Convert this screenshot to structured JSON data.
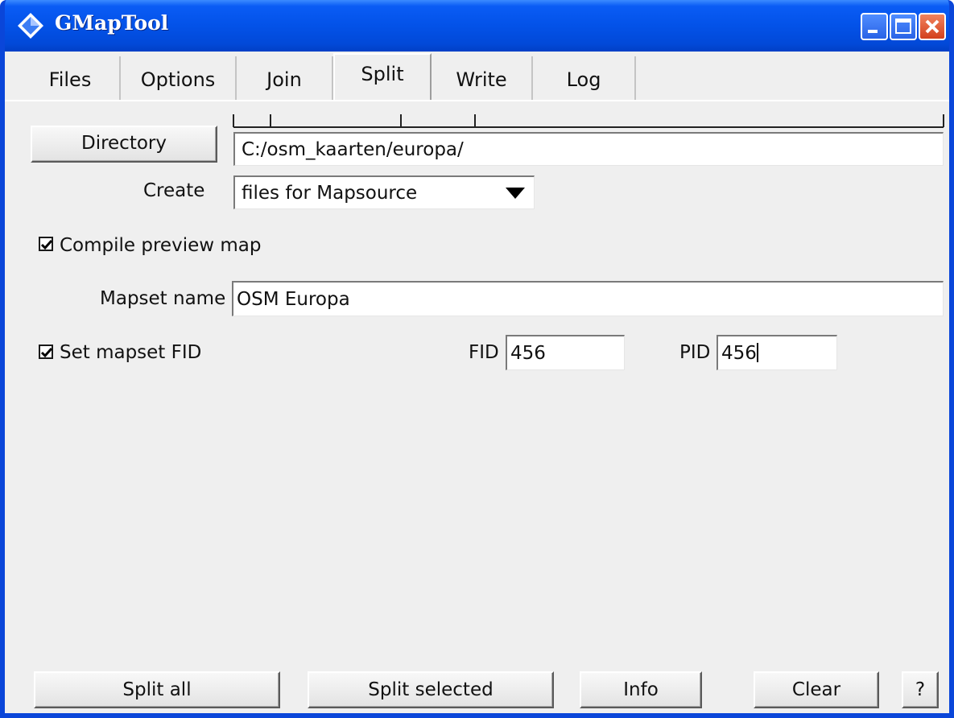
{
  "window": {
    "title": "GMapTool",
    "controls": [
      "minimize-icon",
      "maximize-icon",
      "close-icon"
    ],
    "accent": "#0843d8",
    "close_color": "#d2401d"
  },
  "tabs": [
    {
      "label": "Files",
      "active": false
    },
    {
      "label": "Options",
      "active": false
    },
    {
      "label": "Join",
      "active": false
    },
    {
      "label": "Split",
      "active": true
    },
    {
      "label": "Write",
      "active": false
    },
    {
      "label": "Log",
      "active": false
    }
  ],
  "split": {
    "directory_button": "Directory",
    "directory_value": "C:/osm_kaarten/europa/",
    "create_label": "Create",
    "create_selected": "files for Mapsource",
    "compile_preview_label": "Compile preview map",
    "compile_preview_checked": true,
    "mapset_name_label": "Mapset name",
    "mapset_name_value": "OSM Europa",
    "set_fid_label": "Set mapset FID",
    "set_fid_checked": true,
    "fid_label": "FID",
    "fid_value": "456",
    "pid_label": "PID",
    "pid_value": "456"
  },
  "actions": {
    "split_all": "Split all",
    "split_selected": "Split selected",
    "info": "Info",
    "clear": "Clear",
    "help": "?"
  }
}
